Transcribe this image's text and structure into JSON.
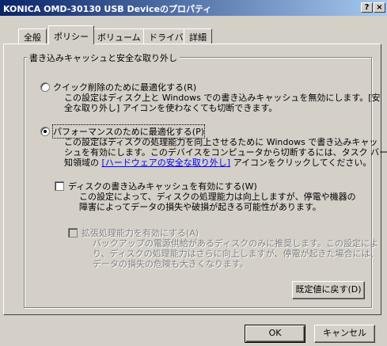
{
  "window": {
    "title": "KONICA OMD-30130 USB Deviceのプロパティ",
    "help_button": "?",
    "close_button": "×"
  },
  "tabs": [
    {
      "label": "全般"
    },
    {
      "label": "ポリシー"
    },
    {
      "label": "ボリューム"
    },
    {
      "label": "ドライバ"
    },
    {
      "label": "詳細"
    }
  ],
  "group": {
    "title": "書き込みキャッシュと安全な取り外し"
  },
  "quick_removal": {
    "label": "クイック削除のために最適化する(R)",
    "desc_line1": "この設定はディスク上と Windows での書き込みキャッシュを無効にします。[安",
    "desc_line2": "全な取り外し] アイコンを使わなくても切断できます。",
    "selected": false
  },
  "performance": {
    "label": "パフォーマンスのために最適化する(P)",
    "desc_line1": "この設定はディスクの処理能力を向上させるために Windows で書き込みキャッ",
    "desc_line2": "シュを有効にします。このデバイスをコンピュータから切断するには、タスク バー通",
    "desc_line3_prefix": "知領域の ",
    "desc_line3_link": "[ハードウェアの安全な取り外し]",
    "desc_line3_suffix": " アイコンをクリックしてください。",
    "selected": true
  },
  "write_cache": {
    "label": "ディスクの書き込みキャッシュを有効にする(W)",
    "desc_line1": "この設定によって、ディスクの処理能力は向上しますが、停電や機器の",
    "desc_line2": "障害によってデータの損失や破損が起きる可能性があります。",
    "checked": false
  },
  "advanced": {
    "label": "拡張処理能力を有効にする(A)",
    "desc_line1": "バックアップの電源供給があるディスクのみに推奨します。この設定によ",
    "desc_line2": "り、ディスクの処理能力はさらに向上しますが、停電が起きた場合には、",
    "desc_line3": "データの損失の危険も大きくなります。",
    "checked": false,
    "enabled": false
  },
  "buttons": {
    "restore_defaults": "既定値に戻す(D)",
    "ok": "OK",
    "cancel": "キャンセル"
  }
}
